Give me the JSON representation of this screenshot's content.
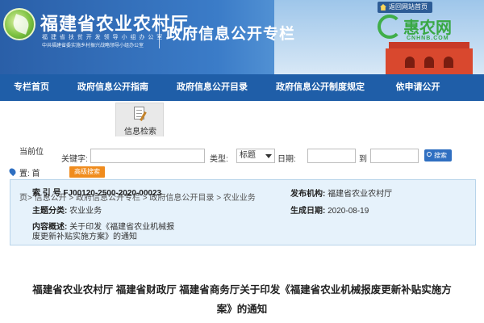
{
  "header": {
    "site_name": "福建省农业农村厅",
    "site_sub1": "福 建 省 扶 贫 开 发 领 导 小 组 办 公 室",
    "site_sub2": "中共福建省委实施乡村振兴战略领导小组办公室",
    "column_title": "政府信息公开专栏",
    "return_link": "返回网站首页",
    "watermark_text": "惠农网",
    "watermark_domain": "CNHNB.COM"
  },
  "nav": {
    "items": [
      {
        "label": "专栏首页"
      },
      {
        "label": "政府信息公开指南"
      },
      {
        "label": "政府信息公开目录"
      },
      {
        "label": "政府信息公开制度规定"
      },
      {
        "label": "依申请公开"
      }
    ]
  },
  "search_tab": {
    "label": "信息检索"
  },
  "search": {
    "current_pos_label": "当前位",
    "keyword_label": "关键字:",
    "keyword_value": "",
    "type_label": "类型:",
    "type_value": "标题",
    "date_label": "日期:",
    "date_from": "",
    "date_to_label": "到",
    "date_to": "",
    "search_button": "搜索",
    "advanced_button": "高级搜索",
    "pos_row": "置: 首"
  },
  "info": {
    "breadcrumb_prefix": "页",
    "breadcrumb": "> 信息公开 > 政府信息公开专栏 > 政府信息公开目录 > 农业业务",
    "index_label": "索 引 号",
    "index_value": "FJ00120-2500-2020-00023",
    "issuer_label": "发布机构:",
    "issuer_value": "福建省农业农村厅",
    "category_label": "主题分类:",
    "category_value": "农业业务",
    "date_label": "生成日期:",
    "date_value": "2020-08-19",
    "summary_label": "内容概述:",
    "summary_line1": "关于印发《福建省农业机械报",
    "summary_line2": "废更新补贴实施方案》的通知"
  },
  "document": {
    "title_line1": "福建省农业农村厅 福建省财政厅 福建省商务厅关于印发《福建省农业机械报废更新补贴实施方",
    "title_line2": "案》的通知"
  }
}
